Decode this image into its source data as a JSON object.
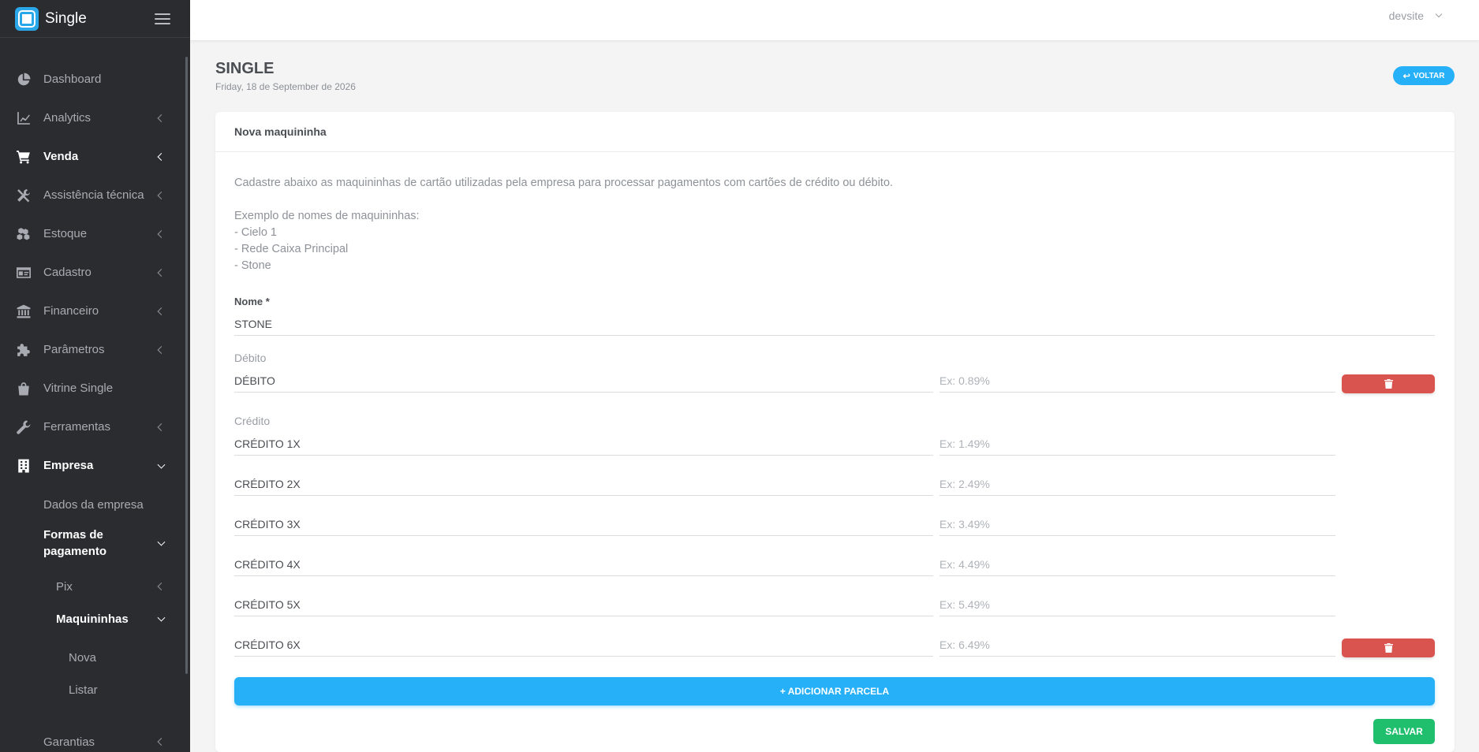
{
  "app": {
    "name": "Single"
  },
  "user": {
    "name": "devsite"
  },
  "sidebar": {
    "items": [
      {
        "label": "Dashboard",
        "icon": "pie-chart-icon"
      },
      {
        "label": "Analytics",
        "icon": "line-chart-icon"
      },
      {
        "label": "Venda",
        "icon": "cart-icon"
      },
      {
        "label": "Assistência técnica",
        "icon": "tools-icon"
      },
      {
        "label": "Estoque",
        "icon": "boxes-icon"
      },
      {
        "label": "Cadastro",
        "icon": "id-card-icon"
      },
      {
        "label": "Financeiro",
        "icon": "bank-icon"
      },
      {
        "label": "Parâmetros",
        "icon": "puzzle-icon"
      },
      {
        "label": "Vitrine Single",
        "icon": "bag-icon"
      },
      {
        "label": "Ferramentas",
        "icon": "wrench-icon"
      },
      {
        "label": "Empresa",
        "icon": "building-icon"
      }
    ],
    "empresa_sub": {
      "dados": "Dados da empresa",
      "formas_line1": "Formas de",
      "formas_line2": "pagamento",
      "pix": "Pix",
      "maquininhas": "Maquininhas",
      "nova": "Nova",
      "listar": "Listar"
    },
    "garantias": "Garantias"
  },
  "page": {
    "title": "SINGLE",
    "date": "Friday, 18 de September de 2026",
    "back_label": "VOLTAR"
  },
  "card": {
    "title": "Nova maquininha",
    "description": "Cadastre abaixo as maquininhas de cartão utilizadas pela empresa para processar pagamentos com cartões de crédito ou débito.",
    "examples_title": "Exemplo de nomes de maquininhas:",
    "examples": [
      "- Cielo 1",
      "- Rede Caixa Principal",
      "- Stone"
    ]
  },
  "form": {
    "name_label": "Nome *",
    "name_value": "STONE",
    "debit_label": "Débito",
    "debit": {
      "name": "DÉBITO",
      "placeholder": "Ex: 0.89%"
    },
    "credit_label": "Crédito",
    "credit": [
      {
        "name": "CRÉDITO 1X",
        "placeholder": "Ex: 1.49%"
      },
      {
        "name": "CRÉDITO 2X",
        "placeholder": "Ex: 2.49%"
      },
      {
        "name": "CRÉDITO 3X",
        "placeholder": "Ex: 3.49%"
      },
      {
        "name": "CRÉDITO 4X",
        "placeholder": "Ex: 4.49%"
      },
      {
        "name": "CRÉDITO 5X",
        "placeholder": "Ex: 5.49%"
      },
      {
        "name": "CRÉDITO 6X",
        "placeholder": "Ex: 6.49%"
      }
    ],
    "add_label": "+ ADICIONAR PARCELA",
    "save_label": "SALVAR"
  },
  "colors": {
    "sidebar_bg": "#2a2c30",
    "accent_blue": "#26b0f7",
    "danger": "#d9534f",
    "success": "#1fbf6d"
  }
}
